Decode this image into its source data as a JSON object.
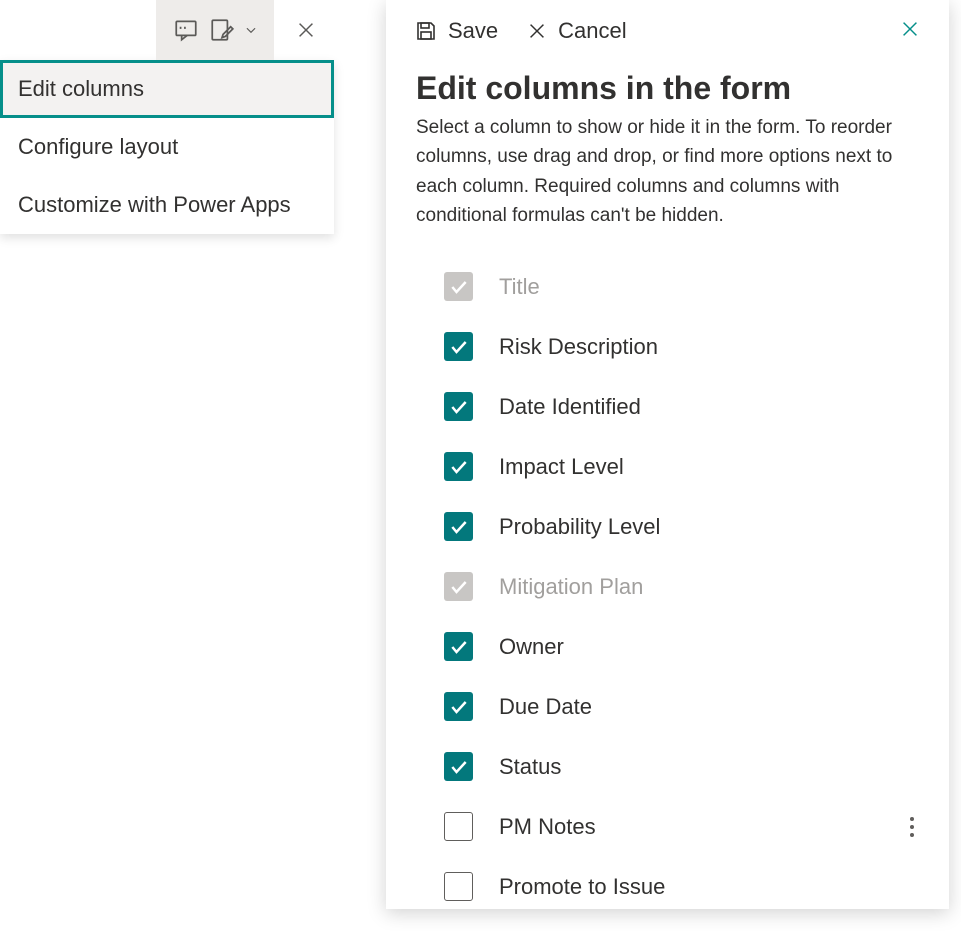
{
  "toolbar": {
    "comment_icon": "comment-icon",
    "edit_icon": "edit-form-icon",
    "chevron_icon": "chevron-down-icon",
    "close_icon": "close-icon"
  },
  "menu": {
    "items": [
      {
        "label": "Edit columns",
        "selected": true
      },
      {
        "label": "Configure layout",
        "selected": false
      },
      {
        "label": "Customize with Power Apps",
        "selected": false
      }
    ]
  },
  "panel": {
    "save_label": "Save",
    "cancel_label": "Cancel",
    "title": "Edit columns in the form",
    "description": "Select a column to show or hide it in the form. To reorder columns, use drag and drop, or find more options next to each column. Required columns and columns with conditional formulas can't be hidden.",
    "columns": [
      {
        "label": "Title",
        "state": "disabled",
        "more": false
      },
      {
        "label": "Risk Description",
        "state": "checked",
        "more": false
      },
      {
        "label": "Date Identified",
        "state": "checked",
        "more": false
      },
      {
        "label": "Impact Level",
        "state": "checked",
        "more": false
      },
      {
        "label": "Probability Level",
        "state": "checked",
        "more": false
      },
      {
        "label": "Mitigation Plan",
        "state": "disabled",
        "more": false
      },
      {
        "label": "Owner",
        "state": "checked",
        "more": false
      },
      {
        "label": "Due Date",
        "state": "checked",
        "more": false
      },
      {
        "label": "Status",
        "state": "checked",
        "more": false
      },
      {
        "label": "PM Notes",
        "state": "unchecked",
        "more": true
      },
      {
        "label": "Promote to Issue",
        "state": "unchecked",
        "more": false
      }
    ]
  },
  "colors": {
    "accent": "#03787c",
    "selection": "#058f8a"
  }
}
